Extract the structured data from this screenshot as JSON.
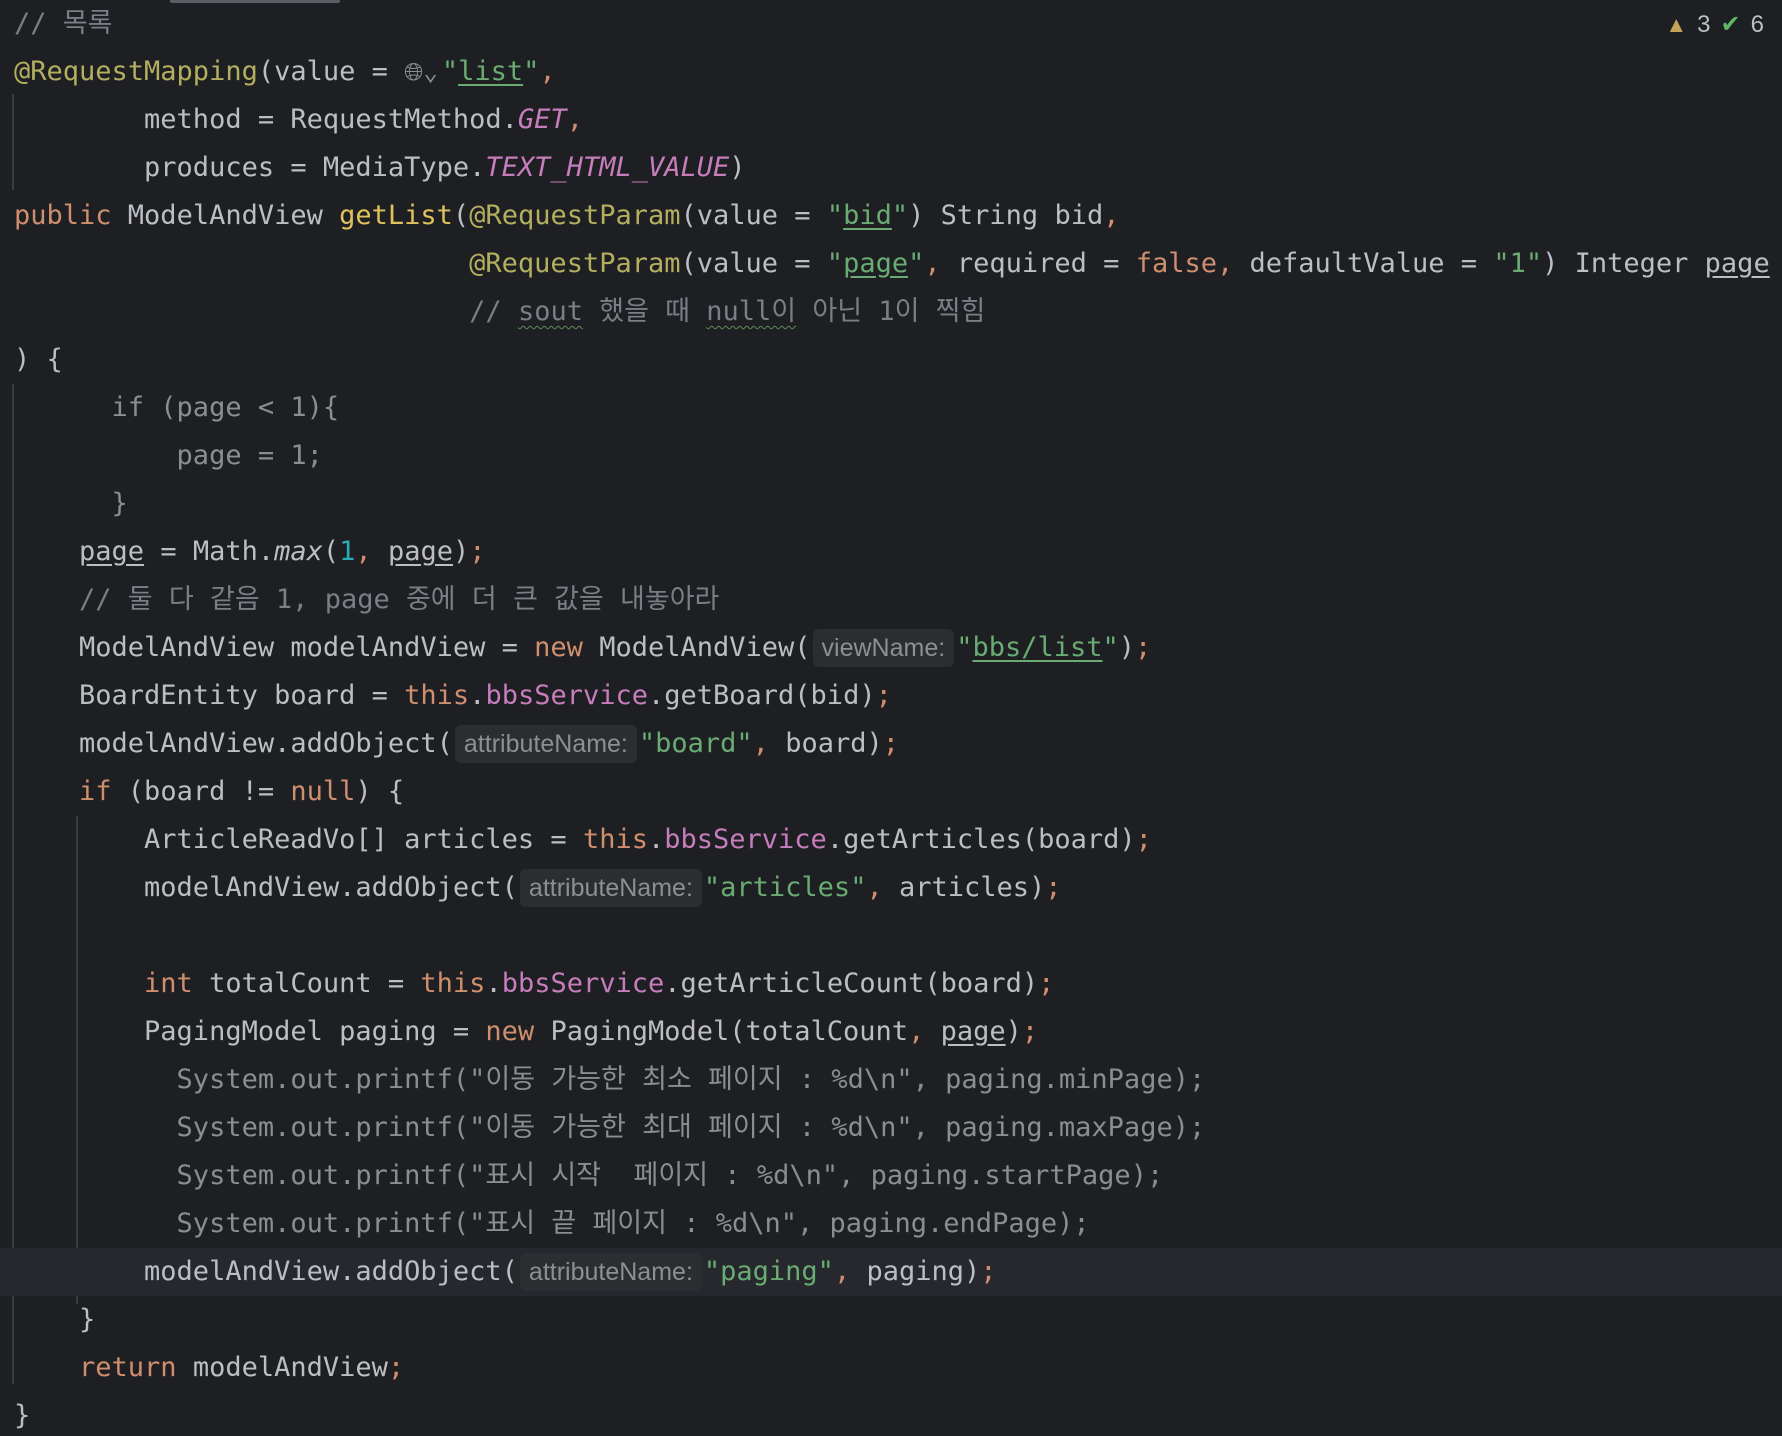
{
  "status": {
    "warnings_count": "3",
    "checks_count": "6",
    "warning_icon": "warning-triangle-icon",
    "check_icon": "double-check-icon"
  },
  "hints": {
    "view_name": "viewName:",
    "attribute_name": "attributeName:"
  },
  "code": {
    "l0_comment": "// 목록",
    "l1_ann": "@RequestMapping",
    "l1_a": "(value = ",
    "l1_str_open": "\"",
    "l1_str_word": "list",
    "l1_str_close": "\"",
    "l1_comma": ",",
    "l2_a": "        method = RequestMethod.",
    "l2_const": "GET",
    "l2_comma": ",",
    "l3_a": "        produces = MediaType.",
    "l3_const": "TEXT_HTML_VALUE",
    "l3_b": ")",
    "l4_kw": "public ",
    "l4_a": "ModelAndView ",
    "l4_fn": "getList",
    "l4_b": "(",
    "l4_ann": "@RequestParam",
    "l4_c": "(value = ",
    "l4_q1": "\"",
    "l4_word": "bid",
    "l4_q2": "\"",
    "l4_d": ") String bid",
    "l4_comma": ",",
    "l5_pad": "                            ",
    "l5_ann": "@RequestParam",
    "l5_a": "(value = ",
    "l5_q1": "\"",
    "l5_word": "page",
    "l5_q2": "\"",
    "l5_comma1": ", ",
    "l5_b": "required = ",
    "l5_kw": "false",
    "l5_comma2": ", ",
    "l5_c": "defaultValue = ",
    "l5_str": "\"1\"",
    "l5_d": ") Integer ",
    "l5_page": "page",
    "l6_pad": "                            ",
    "l6_c1": "// ",
    "l6_sout": "sout",
    "l6_c2": " 했을 때 ",
    "l6_null": "null이",
    "l6_c3": " 아닌 1이 찍힘",
    "l7": ") {",
    "l8": "      if (page < 1){",
    "l9": "          page = 1;",
    "l10": "      }",
    "l11_pad": "    ",
    "l11_page": "page",
    "l11_a": " = Math.",
    "l11_max": "max",
    "l11_b": "(",
    "l11_num": "1",
    "l11_comma": ", ",
    "l11_page2": "page",
    "l11_c": ")",
    "l11_semi": ";",
    "l12_pad": "    ",
    "l12_cmt": "// 둘 다 같음 1, page 중에 더 큰 값을 내놓아라",
    "l13_a": "    ModelAndView modelAndView = ",
    "l13_kw": "new",
    "l13_b": " ModelAndView(",
    "l13_q1": "\"",
    "l13_path": "bbs/list",
    "l13_q2": "\"",
    "l13_c": ")",
    "l13_semi": ";",
    "l14_a": "    BoardEntity board = ",
    "l14_kw": "this",
    "l14_b": ".",
    "l14_field": "bbsService",
    "l14_c": ".getBoard(bid)",
    "l14_semi": ";",
    "l15_a": "    modelAndView.addObject(",
    "l15_str": "\"board\"",
    "l15_comma": ", ",
    "l15_b": "board)",
    "l15_semi": ";",
    "l16_pad": "    ",
    "l16_kw": "if",
    "l16_a": " (board != ",
    "l16_null": "null",
    "l16_b": ") {",
    "l17_a": "        ArticleReadVo[] articles = ",
    "l17_kw": "this",
    "l17_b": ".",
    "l17_field": "bbsService",
    "l17_c": ".getArticles(board)",
    "l17_semi": ";",
    "l18_a": "        modelAndView.addObject(",
    "l18_str": "\"articles\"",
    "l18_comma": ", ",
    "l18_b": "articles)",
    "l18_semi": ";",
    "l20_pad": "        ",
    "l20_kw": "int",
    "l20_a": " totalCount = ",
    "l20_kw2": "this",
    "l20_b": ".",
    "l20_field": "bbsService",
    "l20_c": ".getArticleCount(board)",
    "l20_semi": ";",
    "l21_a": "        PagingModel paging = ",
    "l21_kw": "new",
    "l21_b": " PagingModel(totalCount",
    "l21_comma": ", ",
    "l21_page": "page",
    "l21_c": ")",
    "l21_semi": ";",
    "l22": "          System.out.printf(\"이동 가능한 최소 페이지 : %d\\n\", paging.minPage);",
    "l23": "          System.out.printf(\"이동 가능한 최대 페이지 : %d\\n\", paging.maxPage);",
    "l24": "          System.out.printf(\"표시 시작  페이지 : %d\\n\", paging.startPage);",
    "l25": "          System.out.printf(\"표시 끝 페이지 : %d\\n\", paging.endPage);",
    "l26_a": "        modelAndView.addObject(",
    "l26_str": "\"paging\"",
    "l26_comma": ", ",
    "l26_b": "paging)",
    "l26_semi": ";",
    "l27": "    }",
    "l28_pad": "    ",
    "l28_kw": "return",
    "l28_a": " modelAndView",
    "l28_semi": ";",
    "l29": "}"
  }
}
